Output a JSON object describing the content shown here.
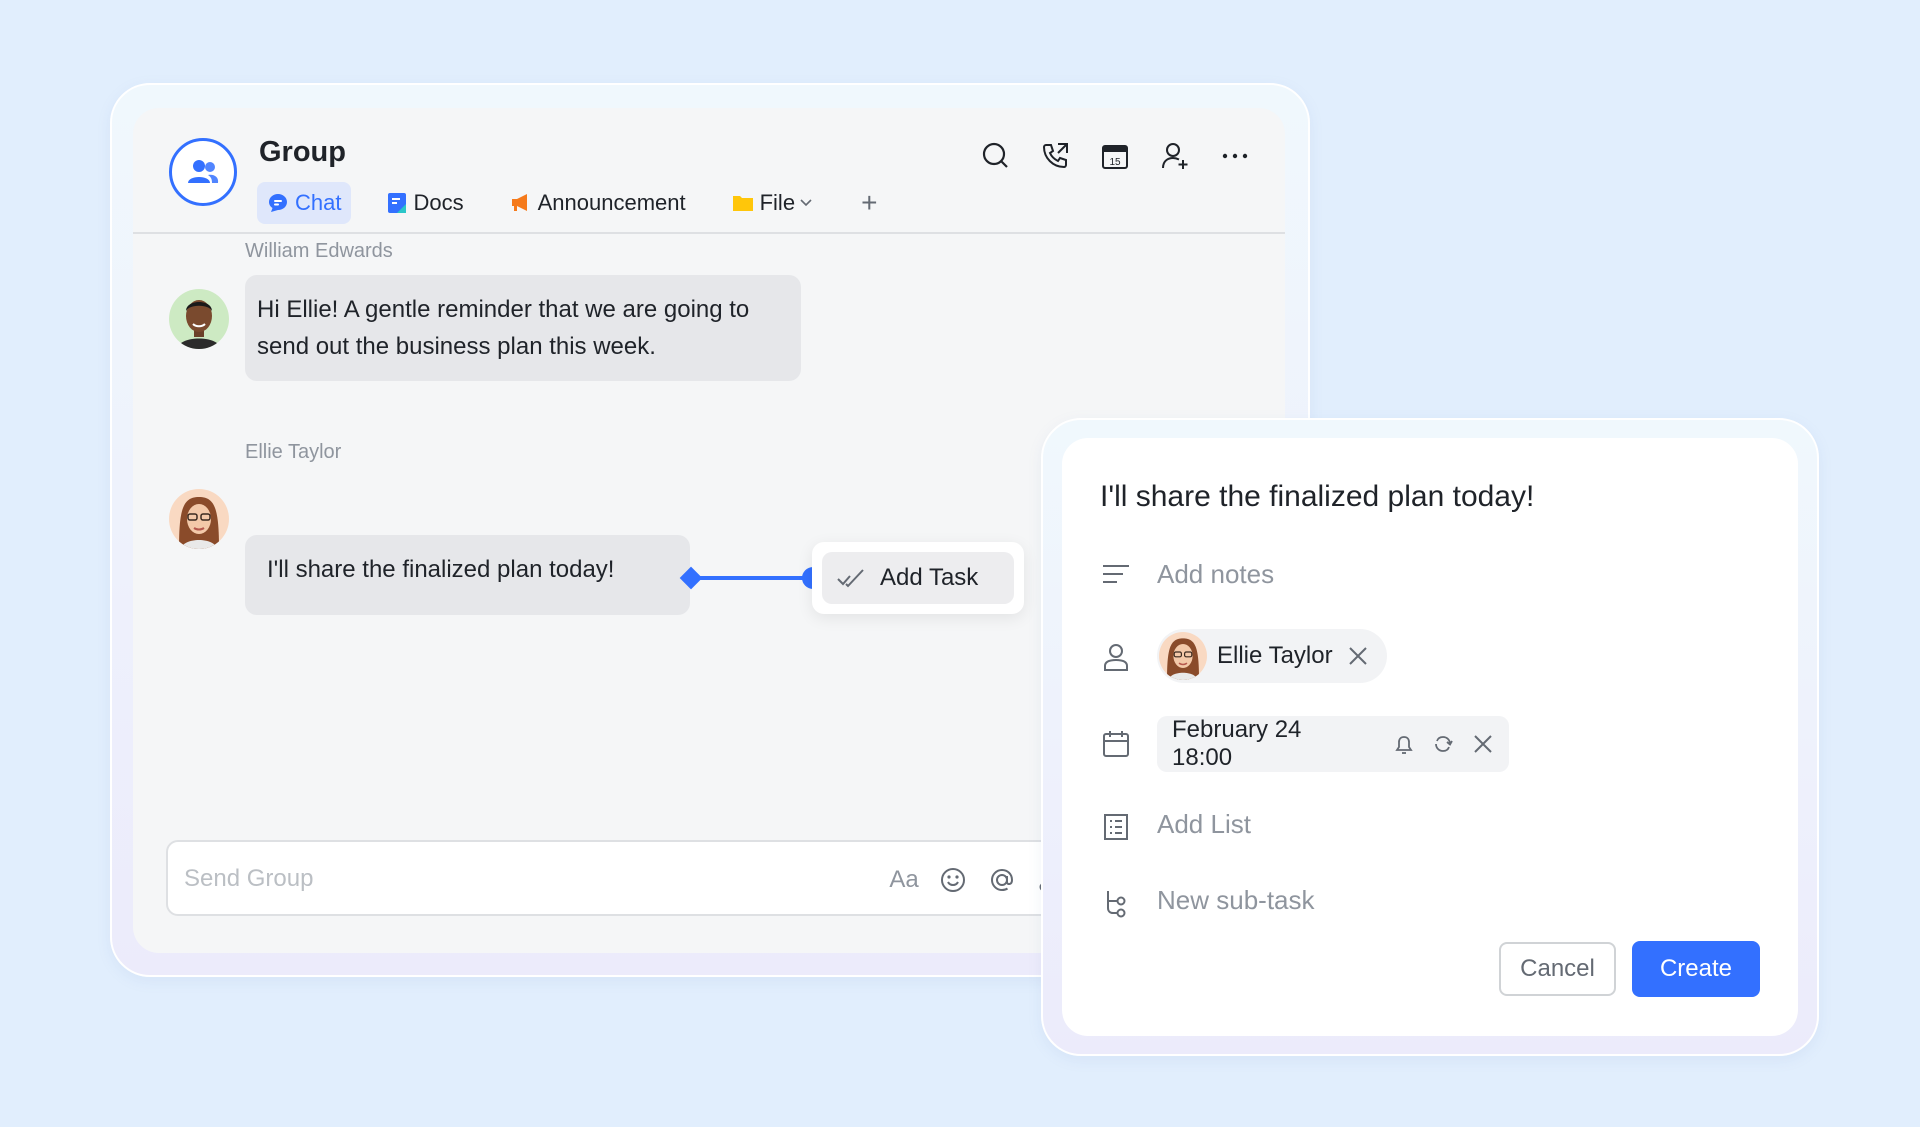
{
  "chat": {
    "group_title": "Group",
    "tabs": [
      {
        "label": "Chat",
        "icon": "chat-bubble-icon",
        "active": true
      },
      {
        "label": "Docs",
        "icon": "docs-icon"
      },
      {
        "label": "Announcement",
        "icon": "megaphone-icon"
      },
      {
        "label": "File",
        "icon": "folder-icon"
      }
    ],
    "add_tab_glyph": "+",
    "header_icons": [
      "search-icon",
      "phone-icon",
      "calendar-icon",
      "add-member-icon",
      "more-icon"
    ],
    "calendar_day": "15",
    "messages": [
      {
        "sender": "William Edwards",
        "text": "Hi Ellie! A gentle reminder that we are going to send out the business plan this week."
      },
      {
        "sender": "Ellie Taylor",
        "text": "I'll share the finalized plan today!"
      }
    ],
    "add_task_label": "Add Task",
    "composer": {
      "placeholder": "Send Group",
      "font_icon_label": "Aa",
      "icons": [
        "font-format-icon",
        "emoji-icon",
        "mention-icon",
        "scissors-icon"
      ]
    }
  },
  "task_panel": {
    "title": "I'll share the finalized plan today!",
    "notes_placeholder": "Add notes",
    "assignee": "Ellie Taylor",
    "due": "February 24 18:00",
    "list_placeholder": "Add List",
    "subtask_placeholder": "New sub-task",
    "cancel_label": "Cancel",
    "create_label": "Create"
  },
  "colors": {
    "background": "#e1eefd",
    "accent": "#3370ff",
    "announcement": "#f57a1b",
    "folder": "#ffc60a"
  }
}
